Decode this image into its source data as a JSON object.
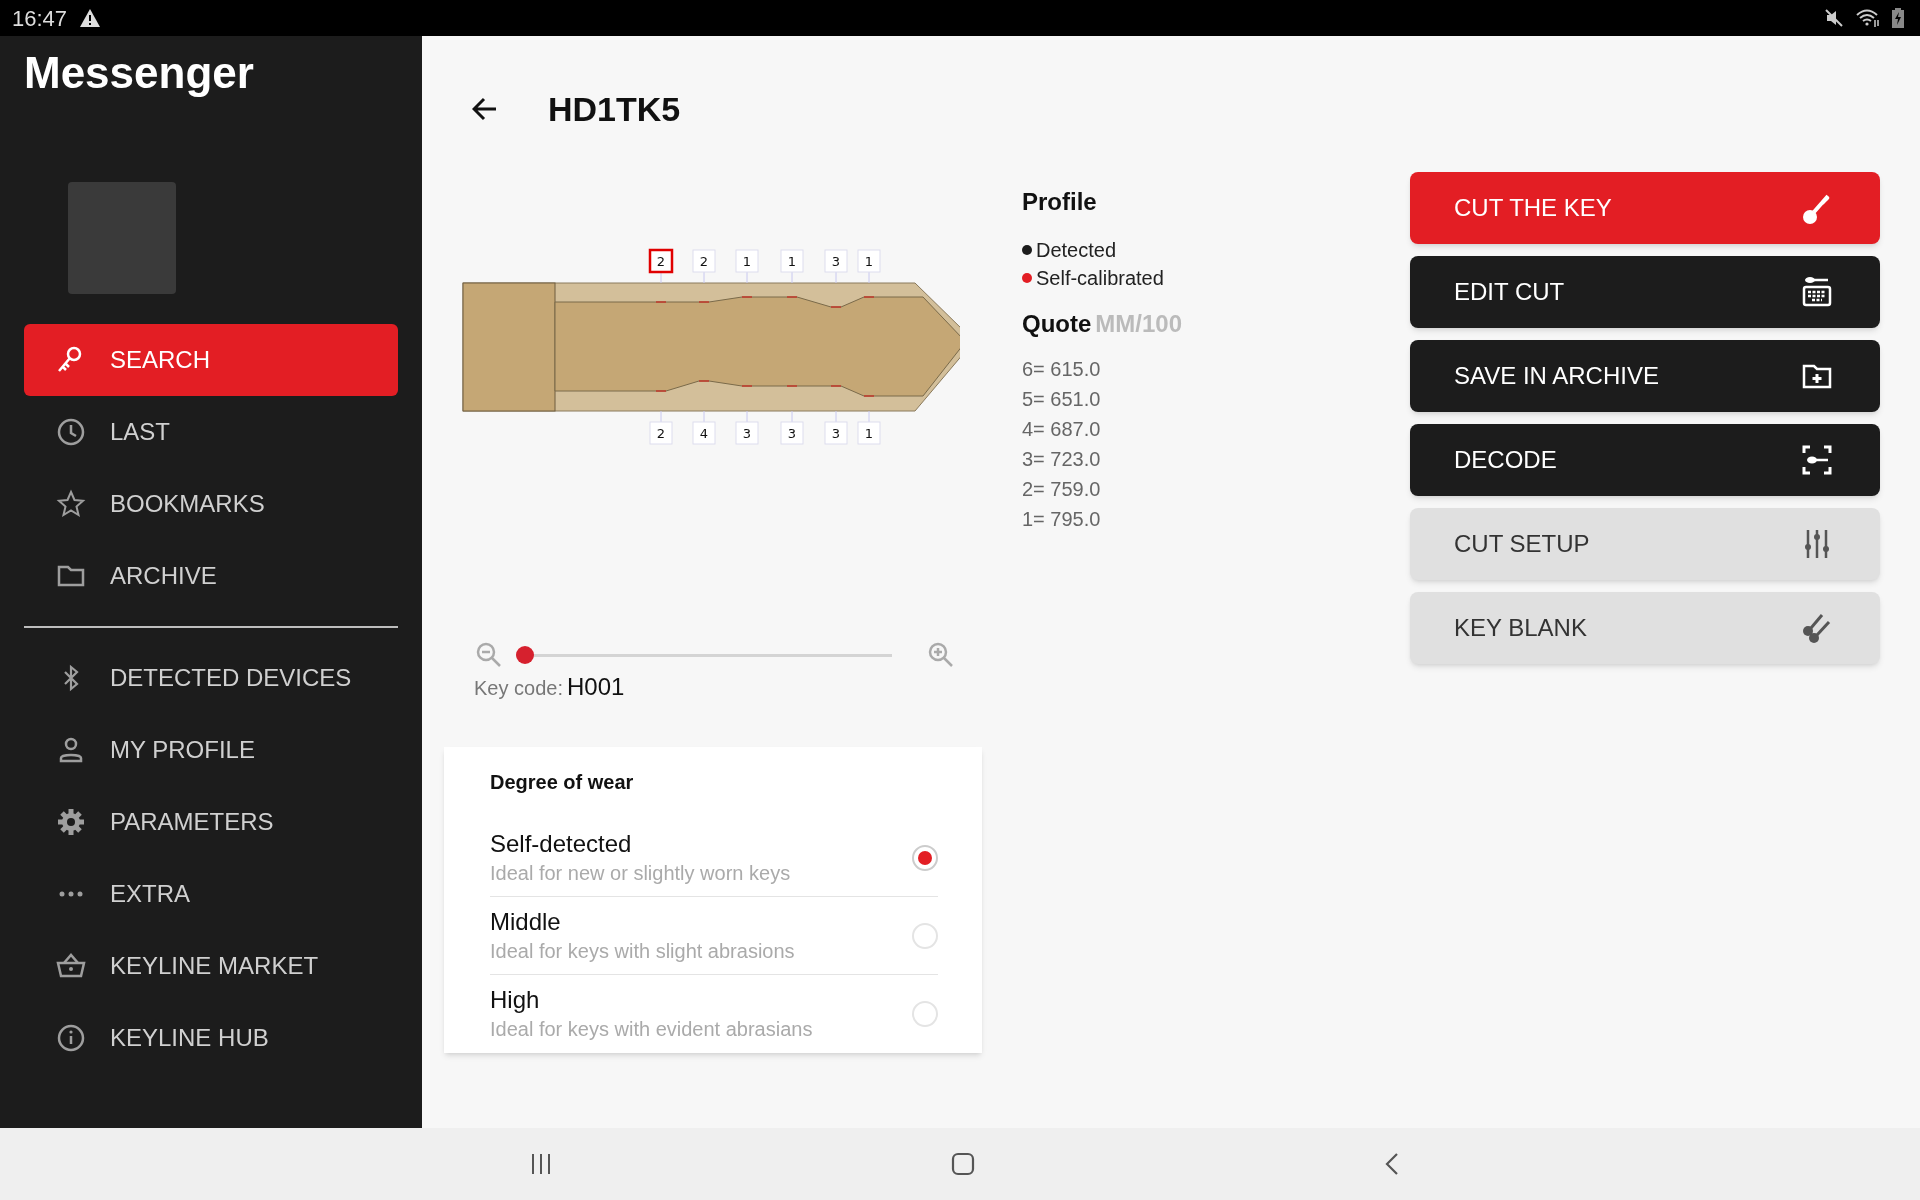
{
  "status_bar": {
    "time": "16:47"
  },
  "sidebar": {
    "title": "Messenger",
    "items": [
      {
        "label": "SEARCH",
        "selected": true
      },
      {
        "label": "LAST",
        "selected": false
      },
      {
        "label": "BOOKMARKS",
        "selected": false
      },
      {
        "label": "ARCHIVE",
        "selected": false
      }
    ],
    "secondary_items": [
      {
        "label": "DETECTED DEVICES",
        "selected": false
      },
      {
        "label": "MY PROFILE",
        "selected": false
      },
      {
        "label": "PARAMETERS",
        "selected": false
      },
      {
        "label": "EXTRA",
        "selected": false
      },
      {
        "label": "KEYLINE MARKET",
        "selected": false
      },
      {
        "label": "KEYLINE HUB",
        "selected": false
      }
    ]
  },
  "header": {
    "title": "HD1TK5"
  },
  "key": {
    "top_cuts": [
      {
        "label": "2",
        "selected": true
      },
      {
        "label": "2",
        "selected": false
      },
      {
        "label": "1",
        "selected": false
      },
      {
        "label": "1",
        "selected": false
      },
      {
        "label": "3",
        "selected": false
      },
      {
        "label": "1",
        "selected": false
      }
    ],
    "bottom_cuts": [
      {
        "label": "2",
        "selected": false
      },
      {
        "label": "4",
        "selected": false
      },
      {
        "label": "3",
        "selected": false
      },
      {
        "label": "3",
        "selected": false
      },
      {
        "label": "3",
        "selected": false
      },
      {
        "label": "1",
        "selected": false
      }
    ],
    "zoom": {
      "level": 0
    },
    "key_code_label": "Key code:",
    "key_code": "H001"
  },
  "profile": {
    "title": "Profile",
    "legend": [
      {
        "label": "Detected",
        "color": "#1c1c1c"
      },
      {
        "label": "Self-calibrated",
        "color": "#e31e24"
      }
    ],
    "quote_title": "Quote",
    "quote_unit": "MM/100",
    "quotes": [
      "6= 615.0",
      "5= 651.0",
      "4= 687.0",
      "3= 723.0",
      "2= 759.0",
      "1= 795.0"
    ]
  },
  "wear": {
    "title": "Degree of wear",
    "options": [
      {
        "title": "Self-detected",
        "subtitle": "Ideal for new or slightly worn keys",
        "selected": true
      },
      {
        "title": "Middle",
        "subtitle": "Ideal for keys with slight abrasions",
        "selected": false
      },
      {
        "title": "High",
        "subtitle": "Ideal for keys with evident abrasians",
        "selected": false
      }
    ]
  },
  "actions": [
    {
      "label": "CUT THE KEY",
      "kind": "primary"
    },
    {
      "label": "EDIT CUT",
      "kind": "dark"
    },
    {
      "label": "SAVE IN ARCHIVE",
      "kind": "dark"
    },
    {
      "label": "DECODE",
      "kind": "dark"
    },
    {
      "label": "CUT SETUP",
      "kind": "light"
    },
    {
      "label": "KEY BLANK",
      "kind": "light"
    }
  ]
}
